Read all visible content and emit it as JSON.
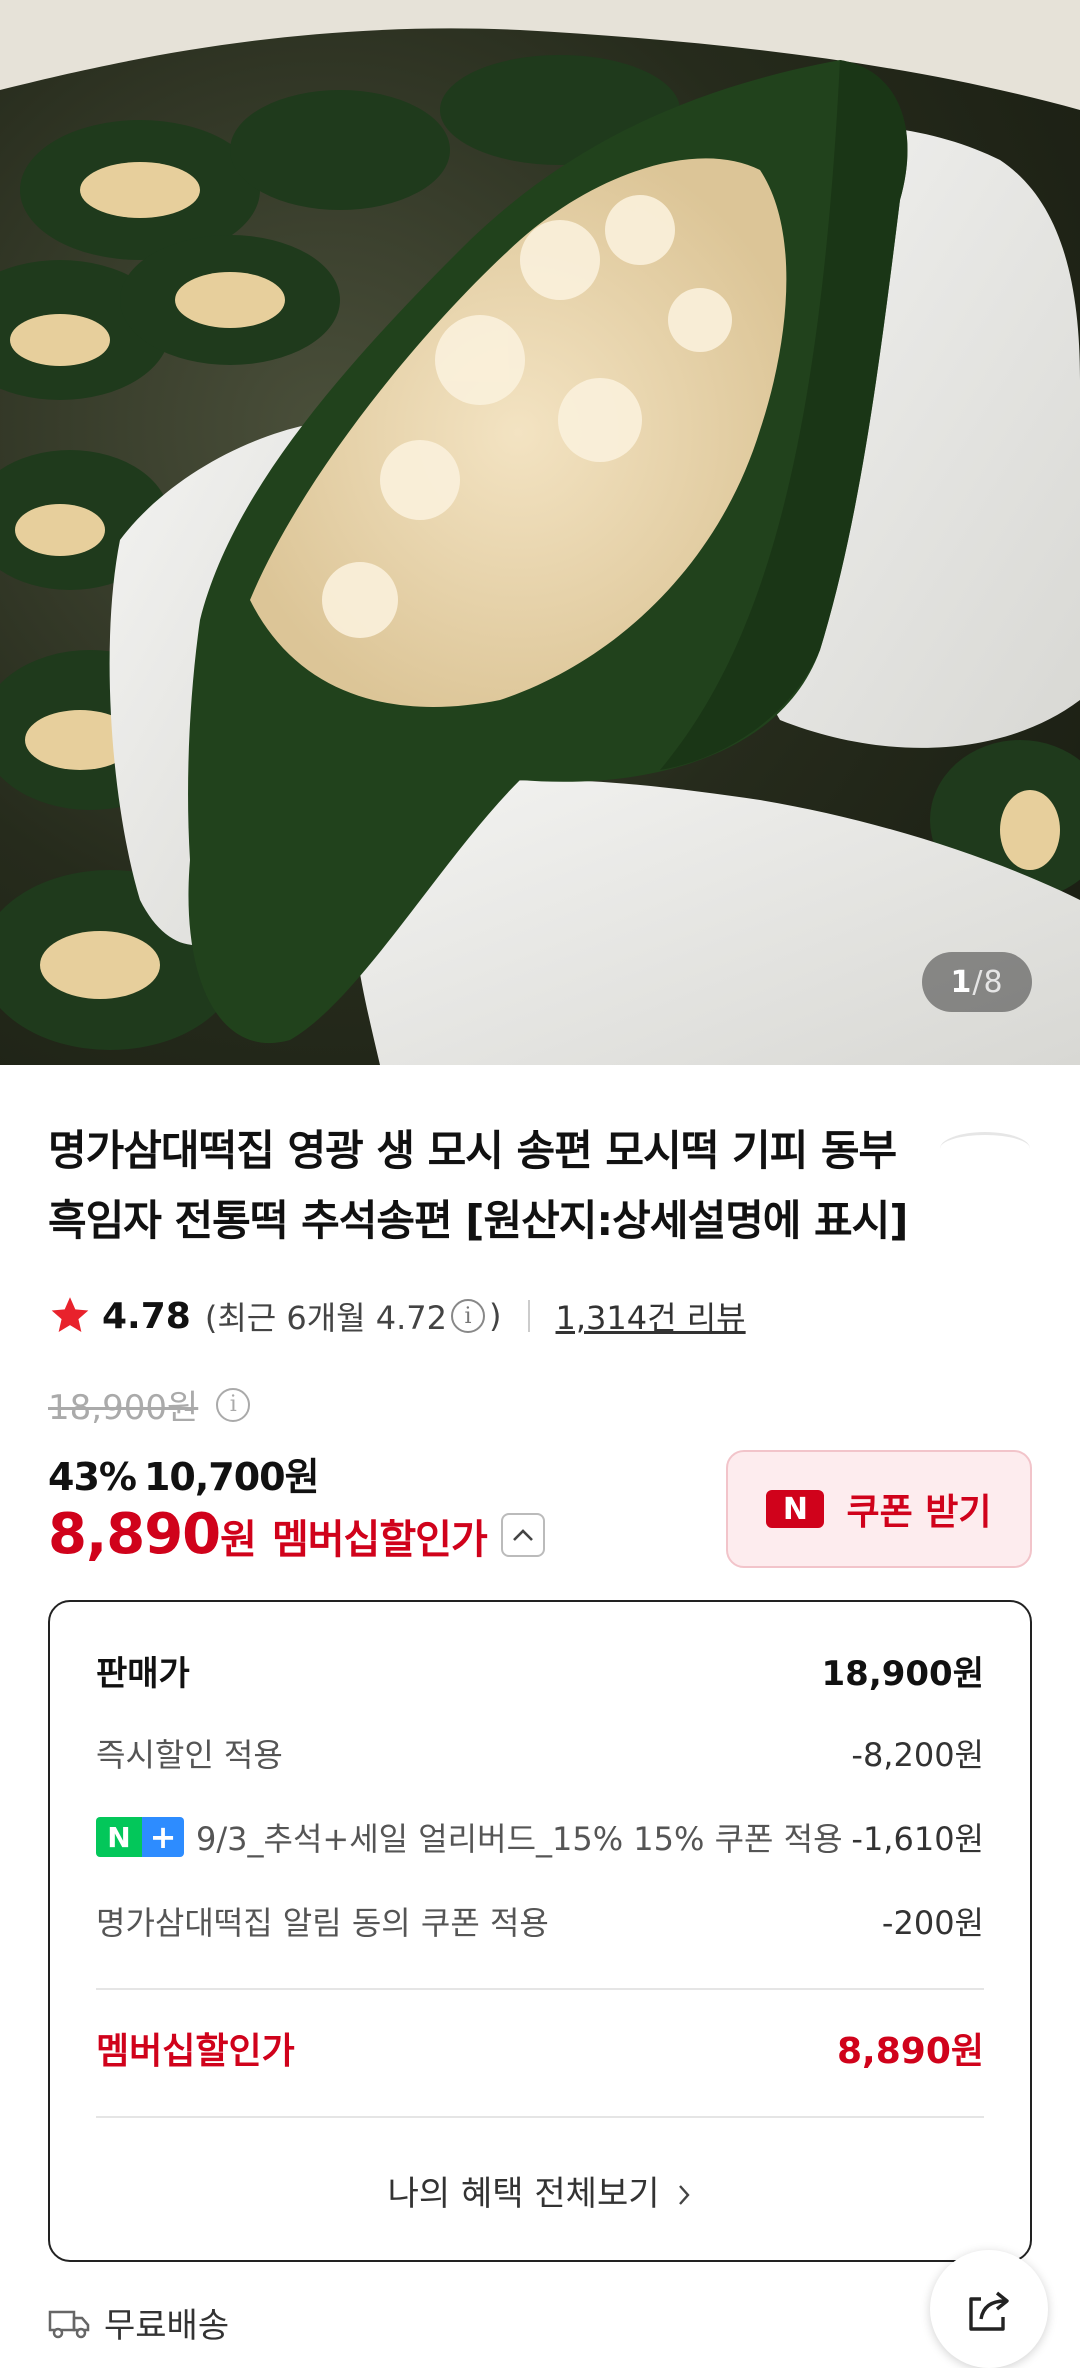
{
  "image": {
    "counter_current": "1",
    "counter_sep": "/",
    "counter_total": "8"
  },
  "product": {
    "title": "명가삼대떡집 영광 생 모시 송편 모시떡 기피 동부 흑임자 전통떡 추석송편 [원산지:상세설명에 표시]"
  },
  "rating": {
    "score": "4.78",
    "recent_prefix": "(최근 6개월 4.72",
    "recent_suffix": ")",
    "reviews": "1,314건 리뷰"
  },
  "price": {
    "original": "18,900원",
    "discount_pct": "43%",
    "discount_price": "10,700원",
    "member_price": "8,890",
    "member_won": "원",
    "member_label": "멤버십할인가",
    "coupon_button": "쿠폰 받기",
    "coupon_logo": "N"
  },
  "breakdown": {
    "rows": [
      {
        "label": "판매가",
        "value": "18,900원"
      },
      {
        "label": "즉시할인 적용",
        "value": "-8,200원"
      },
      {
        "label": "9/3_추석+세일 얼리버드_15% 15% 쿠폰 적용",
        "value": "-1,610원"
      },
      {
        "label": "명가삼대떡집 알림 동의 쿠폰 적용",
        "value": "-200원"
      }
    ],
    "total_label": "멤버십할인가",
    "total_value": "8,890원",
    "view_all": "나의 혜택 전체보기"
  },
  "badge": {
    "n": "N",
    "plus": "+"
  },
  "shipping": {
    "label": "무료배송"
  },
  "colors": {
    "accent_red": "#d0021b",
    "coupon_bg": "#fdecee",
    "npay_green": "#03c75a",
    "plus_blue": "#2d8cff"
  },
  "icons": [
    "star-icon",
    "info-icon",
    "chevron-up-icon",
    "chevron-right-icon",
    "truck-icon",
    "share-icon"
  ]
}
